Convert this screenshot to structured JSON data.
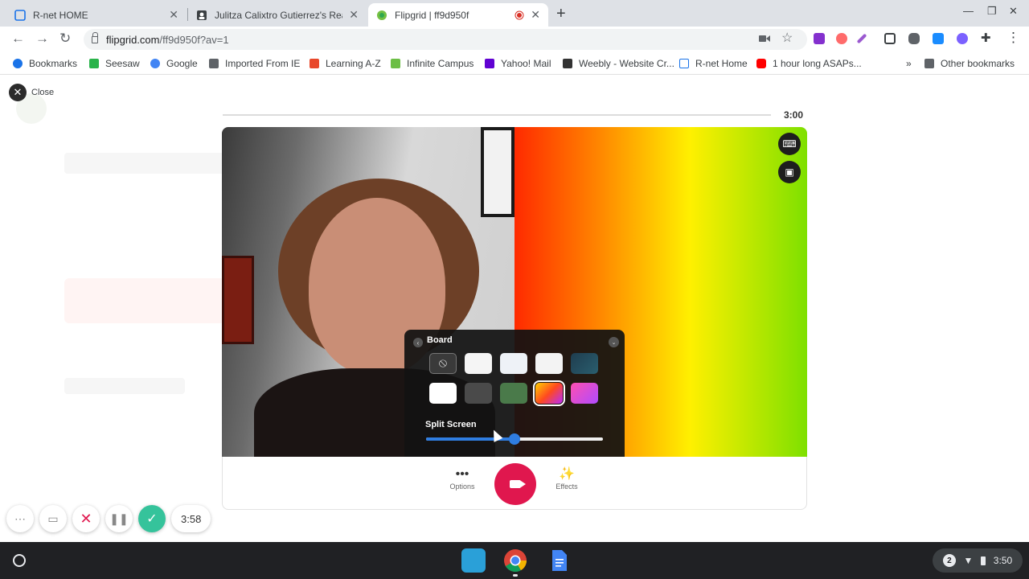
{
  "browser": {
    "tabs": [
      {
        "title": "R-net HOME",
        "active": false,
        "favicon": "rnet-icon"
      },
      {
        "title": "Julitza Calixtro Gutierrez's Read",
        "active": false,
        "favicon": "flipgrid-profile-icon"
      },
      {
        "title": "Flipgrid | ff9d950f",
        "active": true,
        "favicon": "flipgrid-icon",
        "recording": true
      }
    ],
    "url_host": "flipgrid.com",
    "url_path": "/ff9d950f?av=1",
    "bookmarks": [
      {
        "label": "Bookmarks",
        "icon": "star-icon",
        "color": "#1a73e8"
      },
      {
        "label": "Seesaw",
        "icon": "seesaw-icon",
        "color": "#29b34a"
      },
      {
        "label": "Google",
        "icon": "google-icon",
        "color": "#4285f4"
      },
      {
        "label": "Imported From IE",
        "icon": "folder-icon",
        "color": "#5f6368"
      },
      {
        "label": "Learning A-Z",
        "icon": "learning-az-icon",
        "color": "#e8472a"
      },
      {
        "label": "Infinite Campus",
        "icon": "infinite-campus-icon",
        "color": "#6cbe45"
      },
      {
        "label": "Yahoo! Mail",
        "icon": "yahoo-icon",
        "color": "#6001d2"
      },
      {
        "label": "Weebly - Website Cr...",
        "icon": "weebly-icon",
        "color": "#333333"
      },
      {
        "label": "R-net Home",
        "icon": "rnet-icon",
        "color": "#1a73e8"
      },
      {
        "label": "1 hour long ASAPs...",
        "icon": "youtube-icon",
        "color": "#ff0000"
      }
    ],
    "overflow_label": "»",
    "other_bookmarks": "Other bookmarks"
  },
  "page": {
    "close_label": "Close"
  },
  "recorder": {
    "time_remaining": "3:00",
    "board_panel": {
      "title": "Board",
      "swatches": [
        {
          "name": "none-swatch",
          "color": "#3a3a3a",
          "icon": "⃠"
        },
        {
          "name": "grid-white-swatch",
          "color": "#f5f5f5"
        },
        {
          "name": "grid-lined-swatch",
          "color": "#eef2f7"
        },
        {
          "name": "light-grid-swatch",
          "color": "#f3f3f3"
        },
        {
          "name": "dark-teal-swatch",
          "color": "#1f3d4f"
        },
        {
          "name": "white-swatch",
          "color": "#ffffff"
        },
        {
          "name": "dark-gray-swatch",
          "color": "#4a4a4a"
        },
        {
          "name": "green-swatch",
          "color": "#4a7a4a"
        },
        {
          "name": "rainbow-gradient-swatch",
          "color": "#ff5a1f",
          "selected": true
        },
        {
          "name": "pink-purple-gradient-swatch",
          "color": "#d04bff"
        }
      ],
      "split_label": "Split Screen",
      "split_value": 0.5
    },
    "controls": {
      "options_label": "Options",
      "effects_label": "Effects"
    },
    "mini_timer": "3:58"
  },
  "shelf": {
    "apps": [
      "flipgrid-app-icon",
      "chrome-icon",
      "google-docs-icon"
    ],
    "notifications": "2",
    "clock": "3:50"
  }
}
